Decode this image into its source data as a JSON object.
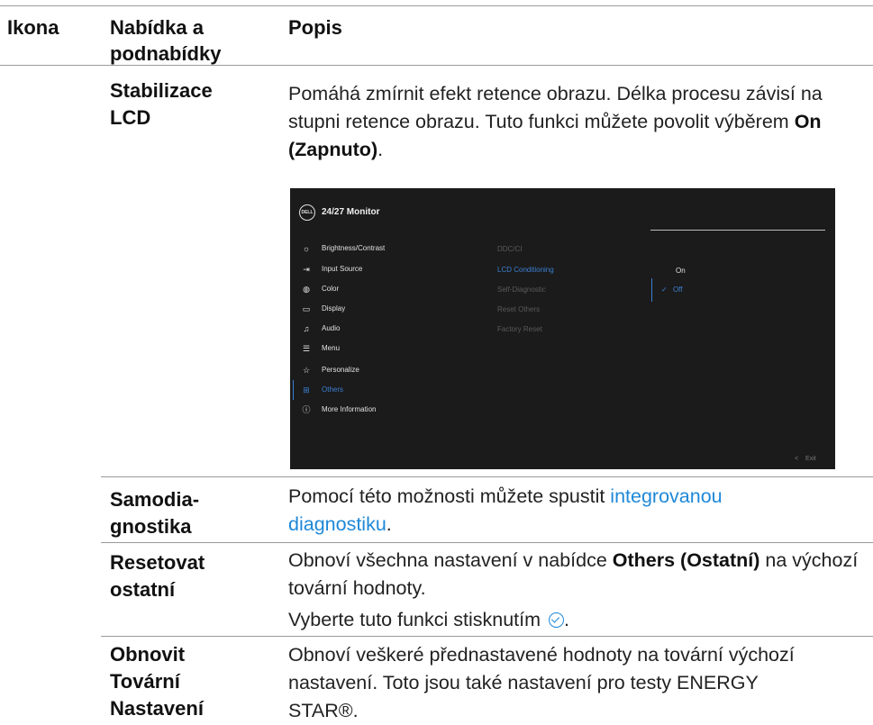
{
  "table": {
    "headers": {
      "icon": "Ikona",
      "menu": "Nabídka a podnabídky",
      "desc": "Popis"
    },
    "rows": [
      {
        "menu": "Stabilizace LCD",
        "desc_part1": "Pomáhá zmírnit efekt retence obrazu. Délka procesu závisí na stupni retence obrazu. Tuto funkci můžete povolit výběrem ",
        "desc_bold": "On (Zapnuto)",
        "desc_end": "."
      },
      {
        "menu_line1": "Samodia-",
        "menu_line2": "gnostika",
        "desc_part1": "Pomocí této možnosti můžete spustit ",
        "desc_link": "integrovanou diagnostiku",
        "desc_end": "."
      },
      {
        "menu": "Resetovat ostatní",
        "desc_part1": "Obnoví všechna nastavení v nabídce ",
        "desc_bold": "Others (Ostatní)",
        "desc_part2": " na výchozí tovární hodnoty.",
        "desc2_part1": "Vyberte tuto funkci stisknutím ",
        "desc2_icon": "check-circle-icon",
        "desc2_end": "."
      },
      {
        "menu": "Obnovit Tovární Nastavení",
        "desc": "Obnoví veškeré přednastavené hodnoty na tovární výchozí nastavení. Toto jsou také nastavení pro testy ENERGY STAR®."
      }
    ]
  },
  "osd": {
    "logo": "DELL",
    "title": "24/27 Monitor",
    "menu": [
      {
        "icon": "brightness-icon",
        "glyph": "☼",
        "label": "Brightness/Contrast"
      },
      {
        "icon": "input-source-icon",
        "glyph": "⇥",
        "label": "Input Source"
      },
      {
        "icon": "color-icon",
        "glyph": "◍",
        "label": "Color"
      },
      {
        "icon": "display-icon",
        "glyph": "▭",
        "label": "Display"
      },
      {
        "icon": "audio-icon",
        "glyph": "♫",
        "label": "Audio"
      },
      {
        "icon": "menu-icon",
        "glyph": "☰",
        "label": "Menu"
      },
      {
        "icon": "personalize-icon",
        "glyph": "☆",
        "label": "Personalize"
      },
      {
        "icon": "others-icon",
        "glyph": "⊞",
        "label": "Others"
      },
      {
        "icon": "info-icon",
        "glyph": "ⓘ",
        "label": "More Information"
      }
    ],
    "submenu": [
      "DDC/CI",
      "LCD Conditioning",
      "Self-Diagnostic",
      "Reset Others",
      "Factory Reset"
    ],
    "options": [
      "On",
      "Off"
    ],
    "option_check": "✓",
    "exit": "Exit",
    "exit_glyph": "<",
    "accent_color": "#3b7fd1"
  }
}
